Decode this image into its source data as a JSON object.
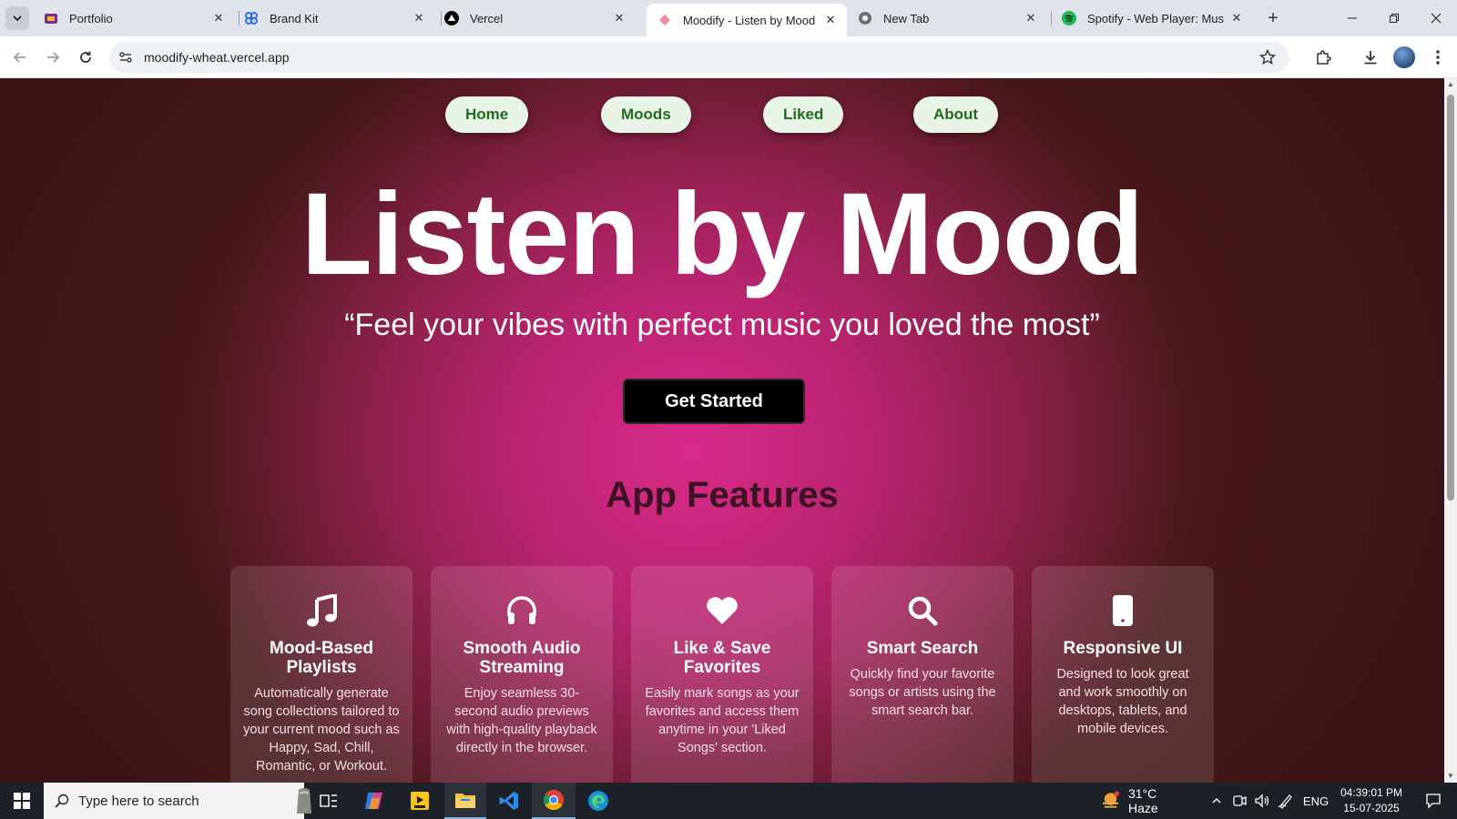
{
  "browser": {
    "tabs": [
      {
        "label": "Portfolio",
        "active": false
      },
      {
        "label": "Brand Kit",
        "active": false
      },
      {
        "label": "Vercel",
        "active": false
      },
      {
        "label": "Moodify - Listen by Mood",
        "active": true
      },
      {
        "label": "New Tab",
        "active": false
      },
      {
        "label": "Spotify - Web Player: Music f",
        "active": false
      }
    ],
    "url": "moodify-wheat.vercel.app"
  },
  "page": {
    "nav": [
      "Home",
      "Moods",
      "Liked",
      "About"
    ],
    "hero_title": "Listen by Mood",
    "hero_subtitle": "“Feel your vibes with perfect music you loved the most”",
    "cta_label": "Get Started",
    "features_title": "App Features",
    "features": [
      {
        "icon": "music-note-icon",
        "title": "Mood-Based Playlists",
        "text": "Automatically generate song collections tailored to your current mood such as Happy, Sad, Chill, Romantic, or Workout."
      },
      {
        "icon": "headphones-icon",
        "title": "Smooth Audio Streaming",
        "text": "Enjoy seamless 30-second audio previews with high-quality playback directly in the browser."
      },
      {
        "icon": "heart-icon",
        "title": "Like & Save Favorites",
        "text": "Easily mark songs as your favorites and access them anytime in your 'Liked Songs' section."
      },
      {
        "icon": "search-icon",
        "title": "Smart Search",
        "text": "Quickly find your favorite songs or artists using the smart search bar."
      },
      {
        "icon": "mobile-icon",
        "title": "Responsive UI",
        "text": "Designed to look great and work smoothly on desktops, tablets, and mobile devices."
      }
    ]
  },
  "taskbar": {
    "search_placeholder": "Type here to search",
    "weather": "31°C  Haze",
    "language": "ENG",
    "time": "04:39:01 PM",
    "date": "15-07-2025"
  },
  "colors": {
    "accent_pink": "#d92a8a",
    "nav_pill_bg": "#e8f4e6",
    "nav_pill_text": "#1f6d1f",
    "features_title": "#3b1322"
  }
}
